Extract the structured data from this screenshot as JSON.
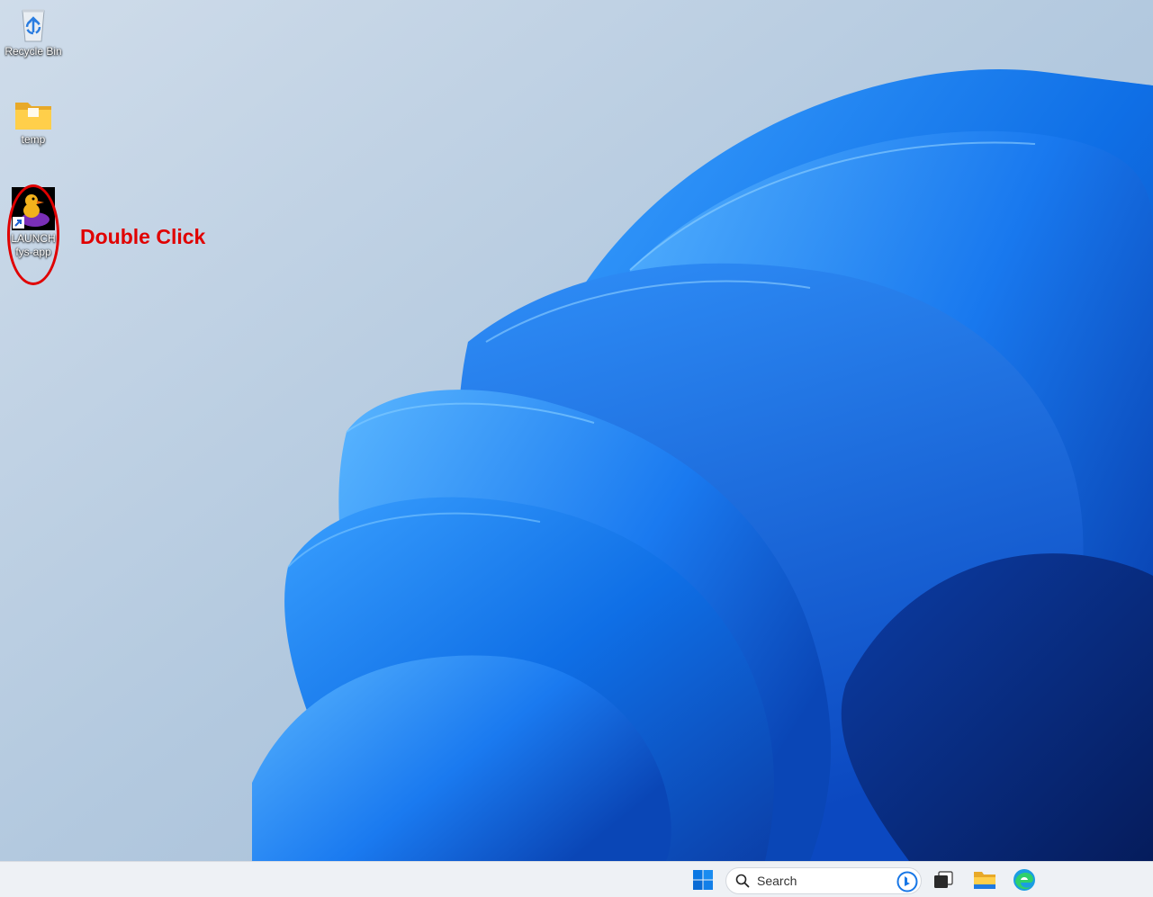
{
  "desktop": {
    "icons": [
      {
        "label": "Recycle Bin",
        "icon": "recycle-bin-icon"
      },
      {
        "label": "temp",
        "icon": "folder-icon"
      },
      {
        "label_line1": "LAUNCH",
        "label_line2": "fys-app",
        "icon": "duck-app-icon"
      }
    ],
    "annotation": {
      "text": "Double Click",
      "color": "#e00000"
    }
  },
  "taskbar": {
    "search_placeholder": "Search",
    "items": [
      "windows-start-icon",
      "bing-icon",
      "task-view-icon",
      "file-explorer-icon",
      "edge-icon"
    ]
  },
  "colors": {
    "accent": "#0b6bd8",
    "annotation": "#e00000",
    "taskbar": "#eef1f5"
  }
}
